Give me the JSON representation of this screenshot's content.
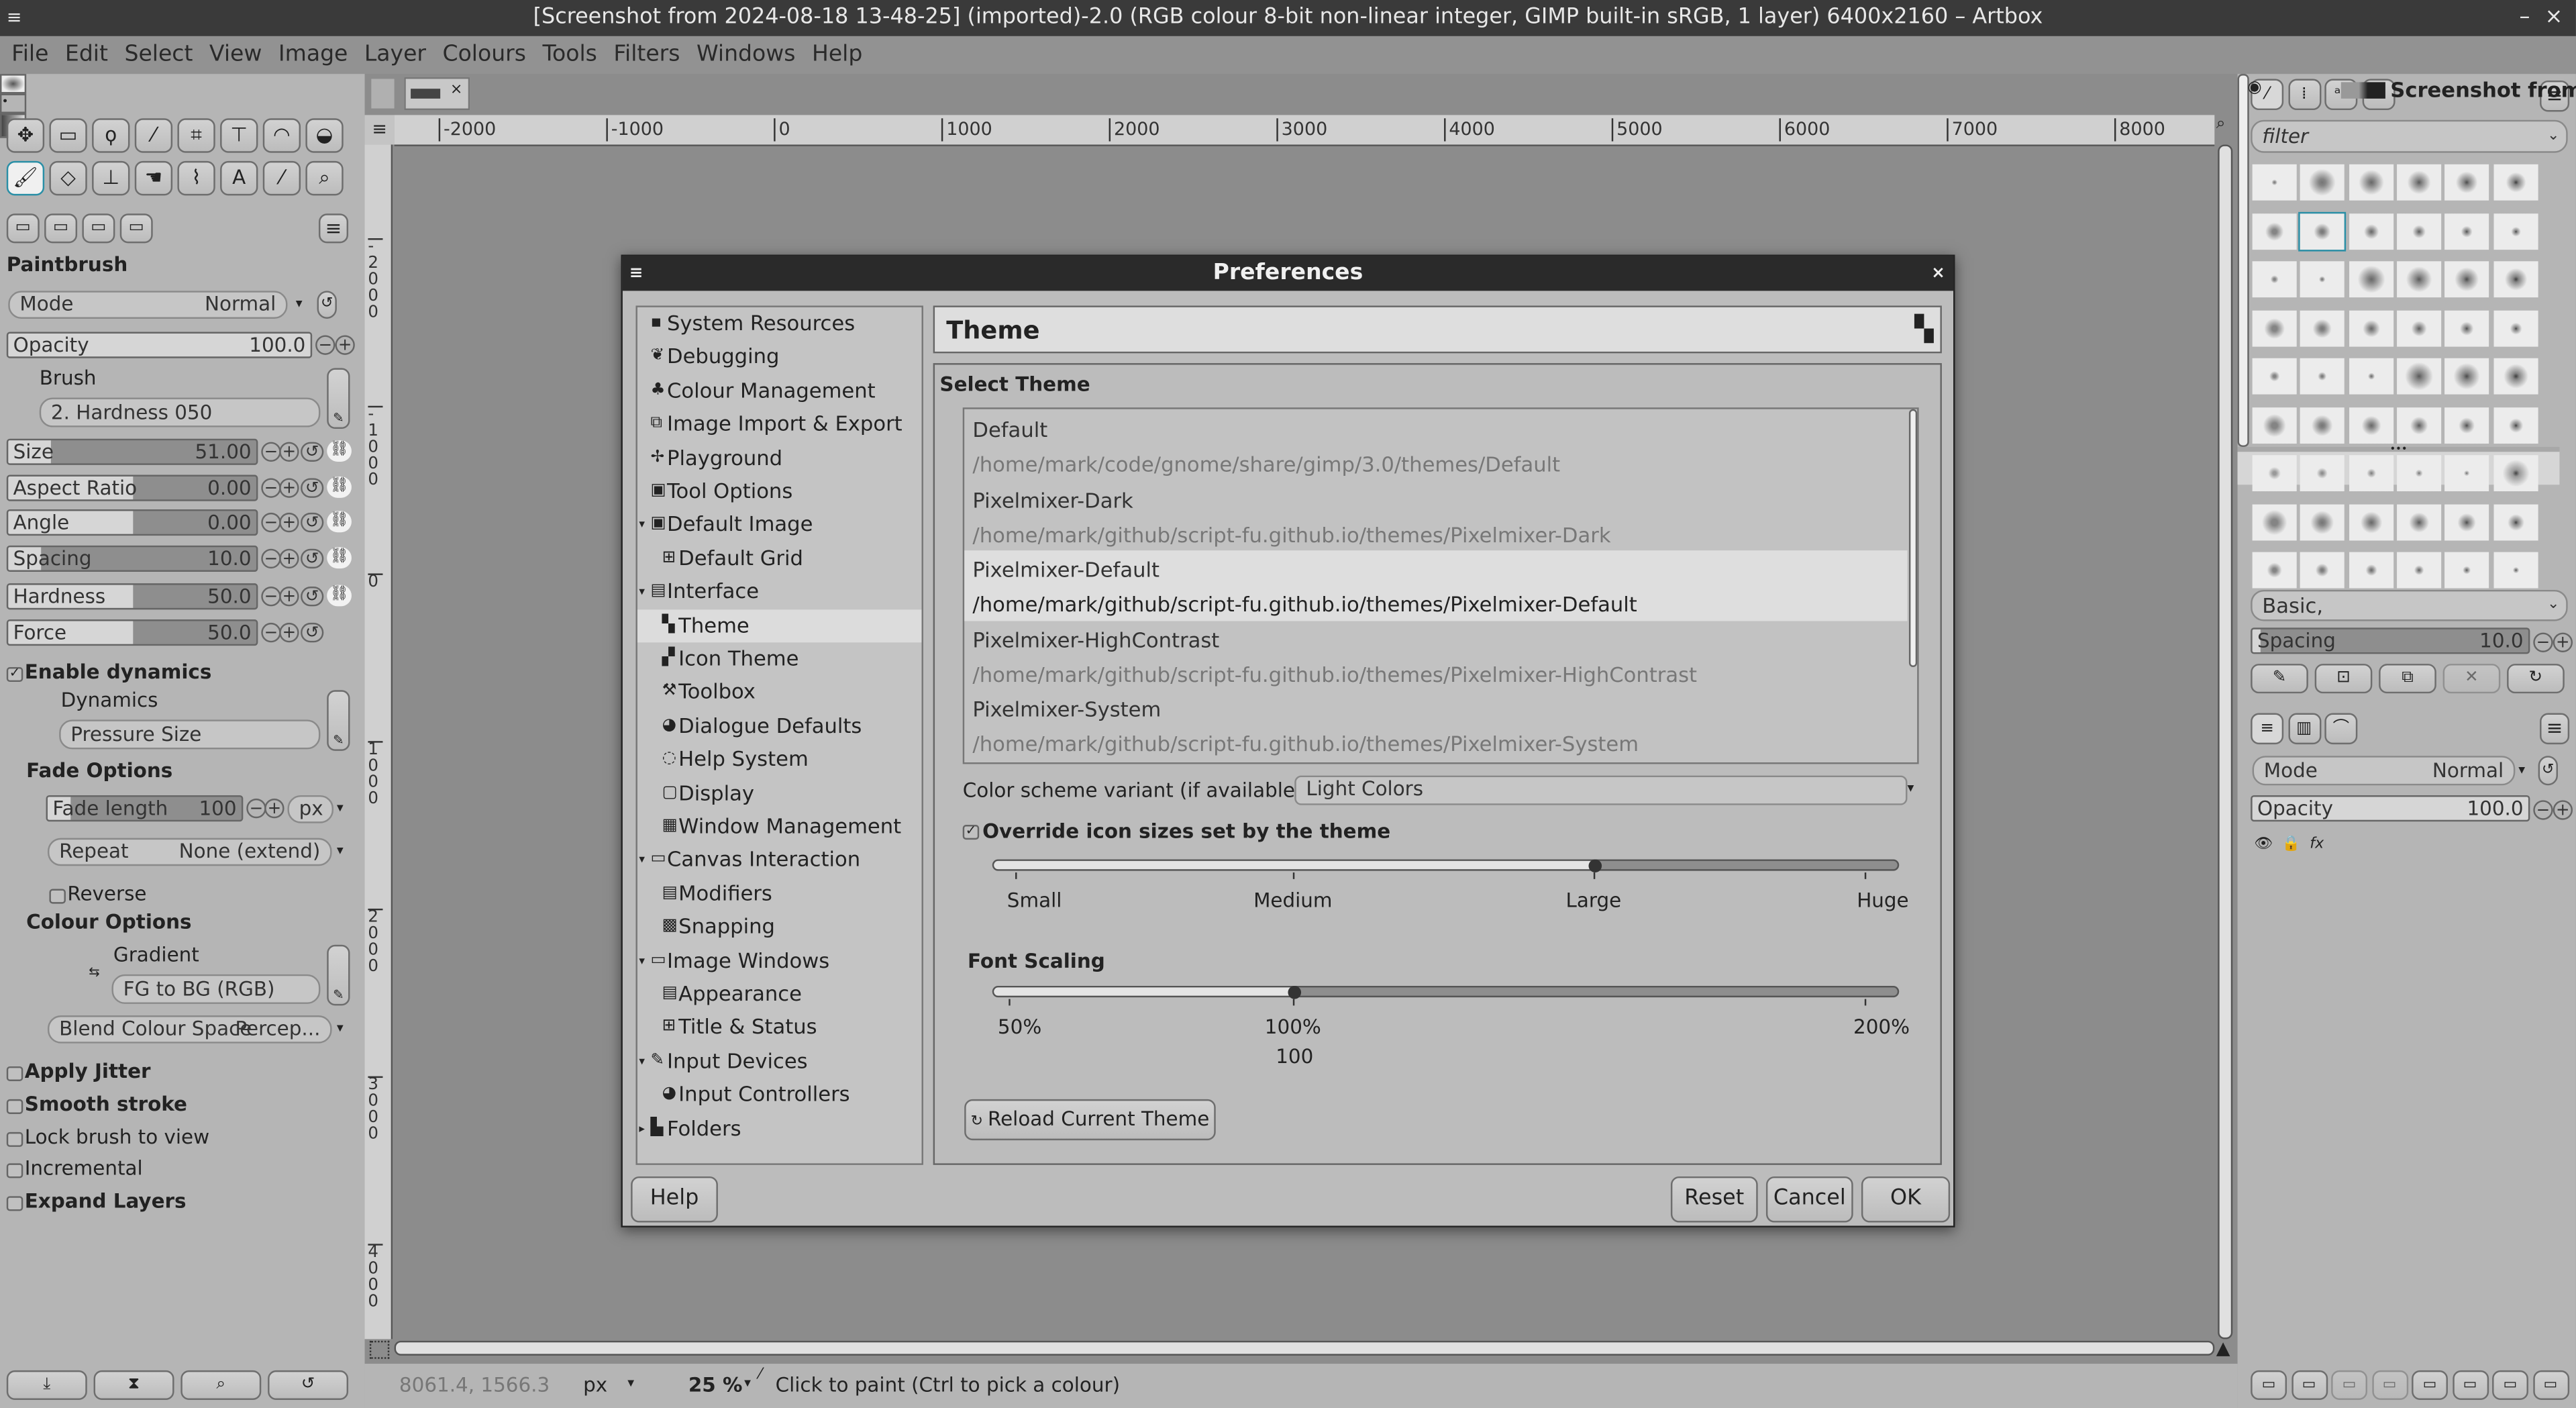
{
  "window": {
    "title": "[Screenshot from 2024-08-18 13-48-25] (imported)-2.0 (RGB colour 8-bit non-linear integer, GIMP built-in sRGB, 1 layer) 6400x2160 – Artbox",
    "menu_icon": "hamburger-icon",
    "controls": [
      "–",
      "×"
    ]
  },
  "menu": [
    "File",
    "Edit",
    "Select",
    "View",
    "Image",
    "Layer",
    "Colours",
    "Tools",
    "Filters",
    "Windows",
    "Help"
  ],
  "toolbox": {
    "tools": [
      {
        "name": "move-tool",
        "glyph": "✥"
      },
      {
        "name": "rect-select-tool",
        "glyph": "▭"
      },
      {
        "name": "lasso-tool",
        "glyph": "ϙ"
      },
      {
        "name": "fuzzy-select-tool",
        "glyph": "⁄"
      },
      {
        "name": "crop-tool",
        "glyph": "⌗"
      },
      {
        "name": "transform-tool",
        "glyph": "⊤"
      },
      {
        "name": "warp-tool",
        "glyph": "◠"
      },
      {
        "name": "bucket-fill-tool",
        "glyph": "◒"
      },
      {
        "name": "paintbrush-tool",
        "glyph": "🖌"
      },
      {
        "name": "eraser-tool",
        "glyph": "◇"
      },
      {
        "name": "clone-tool",
        "glyph": "⊥"
      },
      {
        "name": "smudge-tool",
        "glyph": "☚"
      },
      {
        "name": "paths-tool",
        "glyph": "⌇"
      },
      {
        "name": "text-tool",
        "glyph": "A"
      },
      {
        "name": "color-picker-tool",
        "glyph": "⁄"
      },
      {
        "name": "zoom-tool",
        "glyph": "⌕"
      }
    ],
    "active_tool": 8,
    "tabs": [
      "tool-options-icon",
      "device-status-icon",
      "undo-history-icon",
      "images-icon"
    ]
  },
  "tool_options": {
    "title": "Paintbrush",
    "mode_label": "Mode",
    "mode_value": "Normal",
    "opacity_label": "Opacity",
    "opacity_value": "100.0",
    "brush_label": "Brush",
    "brush_value": "2. Hardness 050",
    "sliders": [
      {
        "label": "Size",
        "value": "51.00",
        "fill": 0.17,
        "chain": true
      },
      {
        "label": "Aspect Ratio",
        "value": "0.00",
        "fill": 0.5,
        "chain": true
      },
      {
        "label": "Angle",
        "value": "0.00",
        "fill": 0.5,
        "chain": true
      },
      {
        "label": "Spacing",
        "value": "10.0",
        "fill": 0.13,
        "chain": true
      },
      {
        "label": "Hardness",
        "value": "50.0",
        "fill": 0.5,
        "chain": true
      },
      {
        "label": "Force",
        "value": "50.0",
        "fill": 0.5,
        "chain": false
      }
    ],
    "enable_dynamics": {
      "label": "Enable dynamics",
      "checked": true
    },
    "dynamics_label": "Dynamics",
    "dynamics_value": "Pressure Size",
    "fade_options": "Fade Options",
    "fade_length_label": "Fade length",
    "fade_length_value": "100",
    "fade_unit": "px",
    "repeat_label": "Repeat",
    "repeat_value": "None (extend)",
    "reverse": {
      "label": "Reverse",
      "checked": false
    },
    "colour_options": "Colour Options",
    "gradient_label": "Gradient",
    "gradient_value": "FG to BG (RGB)",
    "blend_label": "Blend Colour Space",
    "blend_value": "Percep...",
    "options": [
      {
        "label": "Apply Jitter",
        "bold": true,
        "checked": false
      },
      {
        "label": "Smooth stroke",
        "bold": true,
        "checked": false
      },
      {
        "label": "Lock brush to view",
        "bold": false,
        "checked": false
      },
      {
        "label": "Incremental",
        "bold": false,
        "checked": false
      },
      {
        "label": "Expand Layers",
        "bold": true,
        "checked": false
      }
    ],
    "bottom_buttons": [
      "save-preset-icon",
      "restore-preset-icon",
      "delete-preset-icon",
      "reset-icon"
    ]
  },
  "canvas": {
    "ruler_h": [
      "-2000",
      "-1000",
      "0",
      "1000",
      "2000",
      "3000",
      "4000",
      "5000",
      "6000",
      "7000",
      "8000"
    ],
    "ruler_v": [
      "-2000",
      "-1000",
      "0",
      "1000",
      "2000",
      "3000",
      "4000"
    ]
  },
  "status": {
    "coords": "8061.4, 1566.3",
    "unit": "px",
    "zoom": "25 %",
    "message": "Click to paint (Ctrl to pick a colour)"
  },
  "preferences": {
    "title": "Preferences",
    "tree": [
      {
        "label": "System Resources",
        "level": 0,
        "icon": "chip-icon",
        "glyph": "▪"
      },
      {
        "label": "Debugging",
        "level": 0,
        "icon": "wilber-icon",
        "glyph": "❦"
      },
      {
        "label": "Colour Management",
        "level": 0,
        "icon": "colour-icon",
        "glyph": "♣"
      },
      {
        "label": "Image Import & Export",
        "level": 0,
        "icon": "import-icon",
        "glyph": "⧉"
      },
      {
        "label": "Playground",
        "level": 0,
        "icon": "playground-icon",
        "glyph": "✢"
      },
      {
        "label": "Tool Options",
        "level": 0,
        "icon": "tool-options-icon",
        "glyph": "▣"
      },
      {
        "label": "Default Image",
        "level": 0,
        "icon": "image-icon",
        "glyph": "▣",
        "expanded": true
      },
      {
        "label": "Default Grid",
        "level": 1,
        "icon": "grid-icon",
        "glyph": "⊞"
      },
      {
        "label": "Interface",
        "level": 0,
        "icon": "interface-icon",
        "glyph": "▤",
        "expanded": true
      },
      {
        "label": "Theme",
        "level": 1,
        "icon": "theme-icon",
        "glyph": "▚",
        "selected": true
      },
      {
        "label": "Icon Theme",
        "level": 1,
        "icon": "icon-theme-icon",
        "glyph": "▞"
      },
      {
        "label": "Toolbox",
        "level": 1,
        "icon": "toolbox-icon",
        "glyph": "⚒"
      },
      {
        "label": "Dialogue Defaults",
        "level": 1,
        "icon": "dialog-icon",
        "glyph": "◕"
      },
      {
        "label": "Help System",
        "level": 1,
        "icon": "help-icon",
        "glyph": "◌"
      },
      {
        "label": "Display",
        "level": 1,
        "icon": "display-icon",
        "glyph": "▢"
      },
      {
        "label": "Window Management",
        "level": 1,
        "icon": "window-icon",
        "glyph": "▦"
      },
      {
        "label": "Canvas Interaction",
        "level": 0,
        "icon": "canvas-icon",
        "glyph": "▭",
        "expanded": true
      },
      {
        "label": "Modifiers",
        "level": 1,
        "icon": "modifiers-icon",
        "glyph": "▤"
      },
      {
        "label": "Snapping",
        "level": 1,
        "icon": "snapping-icon",
        "glyph": "▩"
      },
      {
        "label": "Image Windows",
        "level": 0,
        "icon": "image-windows-icon",
        "glyph": "▭",
        "expanded": true
      },
      {
        "label": "Appearance",
        "level": 1,
        "icon": "appearance-icon",
        "glyph": "▤"
      },
      {
        "label": "Title & Status",
        "level": 1,
        "icon": "title-status-icon",
        "glyph": "⊞"
      },
      {
        "label": "Input Devices",
        "level": 0,
        "icon": "input-devices-icon",
        "glyph": "✎",
        "expanded": true
      },
      {
        "label": "Input Controllers",
        "level": 1,
        "icon": "controllers-icon",
        "glyph": "◕"
      },
      {
        "label": "Folders",
        "level": 0,
        "icon": "folders-icon",
        "glyph": "▙",
        "collapsed": true
      }
    ],
    "page_title": "Theme",
    "select_theme": "Select Theme",
    "themes": [
      {
        "name": "Default",
        "path": "/home/mark/code/gnome/share/gimp/3.0/themes/Default"
      },
      {
        "name": "Pixelmixer-Dark",
        "path": "/home/mark/github/script-fu.github.io/themes/Pixelmixer-Dark"
      },
      {
        "name": "Pixelmixer-Default",
        "path": "/home/mark/github/script-fu.github.io/themes/Pixelmixer-Default",
        "selected": true
      },
      {
        "name": "Pixelmixer-HighContrast",
        "path": "/home/mark/github/script-fu.github.io/themes/Pixelmixer-HighContrast"
      },
      {
        "name": "Pixelmixer-System",
        "path": "/home/mark/github/script-fu.github.io/themes/Pixelmixer-System"
      }
    ],
    "color_scheme_label": "Color scheme variant (if available)",
    "color_scheme_value": "Light Colors",
    "override_icons": {
      "label": "Override icon sizes set by the theme",
      "checked": true
    },
    "icon_sizes": [
      "Small",
      "Medium",
      "Large",
      "Huge"
    ],
    "icon_size_index": 2,
    "font_scaling_label": "Font Scaling",
    "font_scale_marks": [
      "50%",
      "100%",
      "200%"
    ],
    "font_scale_min": 50,
    "font_scale_max": 200,
    "font_scale_value": 100,
    "font_scale_value_text": "100",
    "reload_button": "Reload Current Theme",
    "buttons": {
      "help": "Help",
      "reset": "Reset",
      "cancel": "Cancel",
      "ok": "OK"
    }
  },
  "right_dock": {
    "tabs": [
      "brushes-icon",
      "patterns-icon",
      "fonts-icon",
      "gradients-icon"
    ],
    "filter_placeholder": "filter",
    "tag_value": "Basic,",
    "spacing_label": "Spacing",
    "spacing_value": "10.0",
    "spacing_fill": 0.03,
    "selected_brush": 7,
    "brush_buttons": [
      "edit-brush-icon",
      "new-brush-icon",
      "duplicate-brush-icon",
      "delete-brush-icon",
      "refresh-brushes-icon"
    ],
    "layers_tabs": [
      "layers-icon",
      "channels-icon",
      "paths-icon"
    ],
    "mode_label": "Mode",
    "mode_value": "Normal",
    "opacity_label": "Opacity",
    "opacity_value": "100.0",
    "layer_name": "Screenshot from",
    "accent": "#2a8fa6"
  }
}
